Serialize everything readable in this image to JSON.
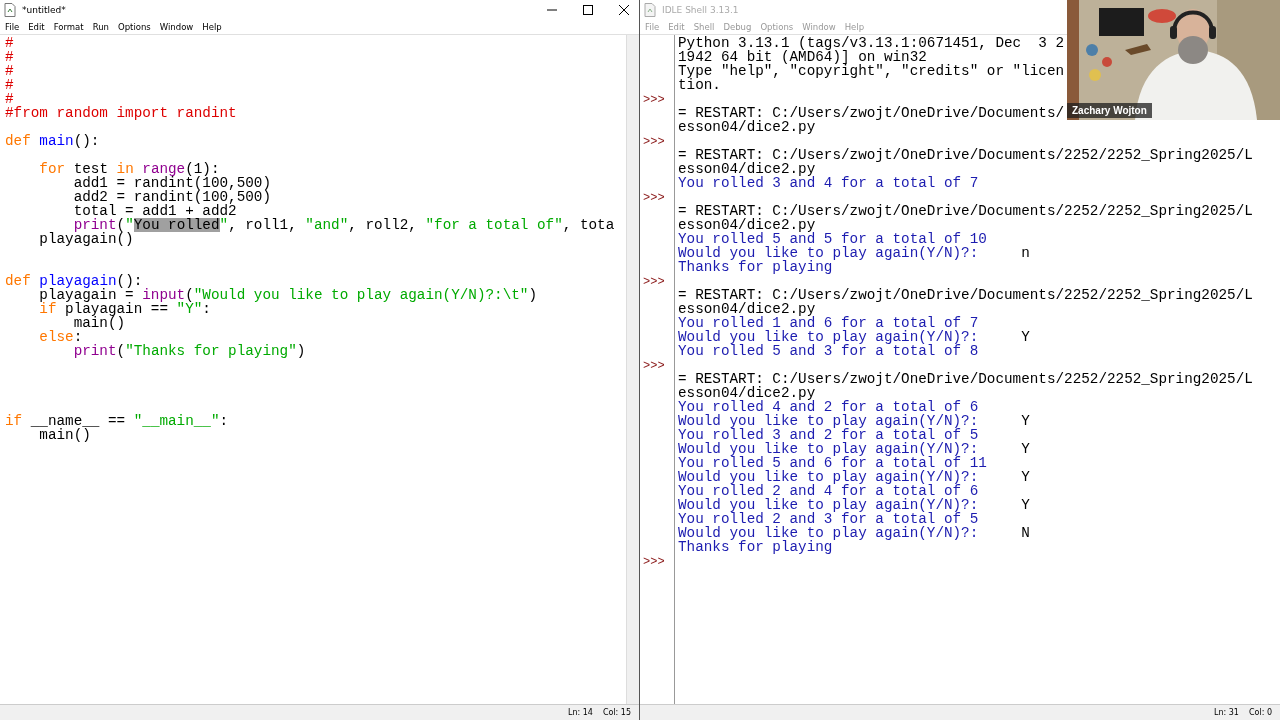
{
  "editor": {
    "title": "*untitled*",
    "menu": [
      "File",
      "Edit",
      "Format",
      "Run",
      "Options",
      "Window",
      "Help"
    ],
    "lines": [
      {
        "tokens": [
          {
            "text": "#",
            "kind": "comment"
          }
        ]
      },
      {
        "tokens": [
          {
            "text": "#",
            "kind": "comment"
          }
        ]
      },
      {
        "tokens": [
          {
            "text": "#",
            "kind": "comment"
          }
        ]
      },
      {
        "tokens": [
          {
            "text": "#",
            "kind": "comment"
          }
        ]
      },
      {
        "tokens": [
          {
            "text": "#",
            "kind": "comment"
          }
        ]
      },
      {
        "tokens": [
          {
            "text": "#from random import randint",
            "kind": "comment"
          }
        ]
      },
      {
        "kind": "blank"
      },
      {
        "tokens": [
          {
            "text": "def ",
            "kind": "keyword"
          },
          {
            "text": "main",
            "kind": "definition"
          },
          {
            "text": "():",
            "kind": "plain"
          }
        ]
      },
      {
        "kind": "blank"
      },
      {
        "tokens": [
          {
            "text": "    for",
            "kind": "keyword"
          },
          {
            "text": " test ",
            "kind": "plain"
          },
          {
            "text": "in ",
            "kind": "keyword"
          },
          {
            "text": "range",
            "kind": "builtin"
          },
          {
            "text": "(1):",
            "kind": "plain"
          }
        ]
      },
      {
        "tokens": [
          {
            "text": "        add1 = randint(100,500)",
            "kind": "plain"
          }
        ]
      },
      {
        "tokens": [
          {
            "text": "        add2 = randint(100,500)",
            "kind": "plain"
          }
        ]
      },
      {
        "tokens": [
          {
            "text": "        total = add1 + add2",
            "kind": "plain"
          }
        ]
      },
      {
        "tokens": [
          {
            "text": "        print",
            "kind": "builtin"
          },
          {
            "text": "(",
            "kind": "plain"
          },
          {
            "text": "\"",
            "kind": "string"
          },
          {
            "text": "You rolled",
            "kind": "selection"
          },
          {
            "text": "\"",
            "kind": "string"
          },
          {
            "text": ", roll1, ",
            "kind": "plain"
          },
          {
            "text": "\"and\"",
            "kind": "string"
          },
          {
            "text": ", roll2, ",
            "kind": "plain"
          },
          {
            "text": "\"for a total of\"",
            "kind": "string"
          },
          {
            "text": ", tota",
            "kind": "plain"
          }
        ]
      },
      {
        "tokens": [
          {
            "text": "    playagain()",
            "kind": "plain"
          }
        ]
      },
      {
        "kind": "blank"
      },
      {
        "kind": "blank"
      },
      {
        "tokens": [
          {
            "text": "def ",
            "kind": "keyword"
          },
          {
            "text": "playagain",
            "kind": "definition"
          },
          {
            "text": "():",
            "kind": "plain"
          }
        ]
      },
      {
        "tokens": [
          {
            "text": "    playagain = ",
            "kind": "plain"
          },
          {
            "text": "input",
            "kind": "builtin"
          },
          {
            "text": "(",
            "kind": "plain"
          },
          {
            "text": "\"Would you like to play again(Y/N)?:\\t\"",
            "kind": "string"
          },
          {
            "text": ")",
            "kind": "plain"
          }
        ]
      },
      {
        "tokens": [
          {
            "text": "    if",
            "kind": "keyword"
          },
          {
            "text": " playagain == ",
            "kind": "plain"
          },
          {
            "text": "\"Y\"",
            "kind": "string"
          },
          {
            "text": ":",
            "kind": "plain"
          }
        ]
      },
      {
        "tokens": [
          {
            "text": "        main()",
            "kind": "plain"
          }
        ]
      },
      {
        "tokens": [
          {
            "text": "    else",
            "kind": "keyword"
          },
          {
            "text": ":",
            "kind": "plain"
          }
        ]
      },
      {
        "tokens": [
          {
            "text": "        print",
            "kind": "builtin"
          },
          {
            "text": "(",
            "kind": "plain"
          },
          {
            "text": "\"Thanks for playing\"",
            "kind": "string"
          },
          {
            "text": ")",
            "kind": "plain"
          }
        ]
      },
      {
        "kind": "blank"
      },
      {
        "kind": "blank"
      },
      {
        "kind": "blank"
      },
      {
        "kind": "blank"
      },
      {
        "tokens": [
          {
            "text": "if",
            "kind": "keyword"
          },
          {
            "text": " __name__ == ",
            "kind": "plain"
          },
          {
            "text": "\"__main__\"",
            "kind": "string"
          },
          {
            "text": ":",
            "kind": "plain"
          }
        ]
      },
      {
        "tokens": [
          {
            "text": "    main()",
            "kind": "plain"
          }
        ]
      }
    ],
    "status": [
      "Ln: 14",
      "Col: 15"
    ]
  },
  "shell": {
    "title": "IDLE Shell 3.13.1",
    "menu": [
      "File",
      "Edit",
      "Shell",
      "Debug",
      "Options",
      "Window",
      "Help"
    ],
    "rows": [
      {
        "kind": "info",
        "text": "Python 3.13.1 (tags/v3.13.1:0671451, Dec  3 2"
      },
      {
        "kind": "info",
        "text": "1942 64 bit (AMD64)] on win32"
      },
      {
        "kind": "info",
        "text": "Type \"help\", \"copyright\", \"credits\" or \"licen"
      },
      {
        "kind": "info",
        "text": "tion."
      },
      {
        "kind": "prompt",
        "prompt": ">>>"
      },
      {
        "kind": "info",
        "text": "= RESTART: C:/Users/zwojt/OneDrive/Documents/"
      },
      {
        "kind": "info",
        "text": "esson04/dice2.py"
      },
      {
        "kind": "prompt",
        "prompt": ">>>"
      },
      {
        "kind": "info",
        "text": "= RESTART: C:/Users/zwojt/OneDrive/Documents/2252/2252_Spring2025/L"
      },
      {
        "kind": "info",
        "text": "esson04/dice2.py"
      },
      {
        "kind": "output",
        "text": "You rolled 3 and 4 for a total of 7"
      },
      {
        "kind": "prompt",
        "prompt": ">>>"
      },
      {
        "kind": "info",
        "text": "= RESTART: C:/Users/zwojt/OneDrive/Documents/2252/2252_Spring2025/L"
      },
      {
        "kind": "info",
        "text": "esson04/dice2.py"
      },
      {
        "kind": "output",
        "text": "You rolled 5 and 5 for a total of 10"
      },
      {
        "kind": "question",
        "text": "Would you like to play again(Y/N)?:",
        "answer": "n"
      },
      {
        "kind": "output",
        "text": "Thanks for playing"
      },
      {
        "kind": "prompt",
        "prompt": ">>>"
      },
      {
        "kind": "info",
        "text": "= RESTART: C:/Users/zwojt/OneDrive/Documents/2252/2252_Spring2025/L"
      },
      {
        "kind": "info",
        "text": "esson04/dice2.py"
      },
      {
        "kind": "output",
        "text": "You rolled 1 and 6 for a total of 7"
      },
      {
        "kind": "question",
        "text": "Would you like to play again(Y/N)?:",
        "answer": "Y"
      },
      {
        "kind": "output",
        "text": "You rolled 5 and 3 for a total of 8"
      },
      {
        "kind": "prompt",
        "prompt": ">>>"
      },
      {
        "kind": "info",
        "text": "= RESTART: C:/Users/zwojt/OneDrive/Documents/2252/2252_Spring2025/L"
      },
      {
        "kind": "info",
        "text": "esson04/dice2.py"
      },
      {
        "kind": "output",
        "text": "You rolled 4 and 2 for a total of 6"
      },
      {
        "kind": "question",
        "text": "Would you like to play again(Y/N)?:",
        "answer": "Y"
      },
      {
        "kind": "output",
        "text": "You rolled 3 and 2 for a total of 5"
      },
      {
        "kind": "question",
        "text": "Would you like to play again(Y/N)?:",
        "answer": "Y"
      },
      {
        "kind": "output",
        "text": "You rolled 5 and 6 for a total of 11"
      },
      {
        "kind": "question",
        "text": "Would you like to play again(Y/N)?:",
        "answer": "Y"
      },
      {
        "kind": "output",
        "text": "You rolled 2 and 4 for a total of 6"
      },
      {
        "kind": "question",
        "text": "Would you like to play again(Y/N)?:",
        "answer": "Y"
      },
      {
        "kind": "output",
        "text": "You rolled 2 and 3 for a total of 5"
      },
      {
        "kind": "question",
        "text": "Would you like to play again(Y/N)?:",
        "answer": "N"
      },
      {
        "kind": "output",
        "text": "Thanks for playing"
      },
      {
        "kind": "prompt",
        "prompt": ">>>"
      }
    ],
    "status": [
      "Ln: 31",
      "Col: 0"
    ]
  },
  "webcam": {
    "kind": "picture",
    "name": "Zachary Wojton"
  }
}
